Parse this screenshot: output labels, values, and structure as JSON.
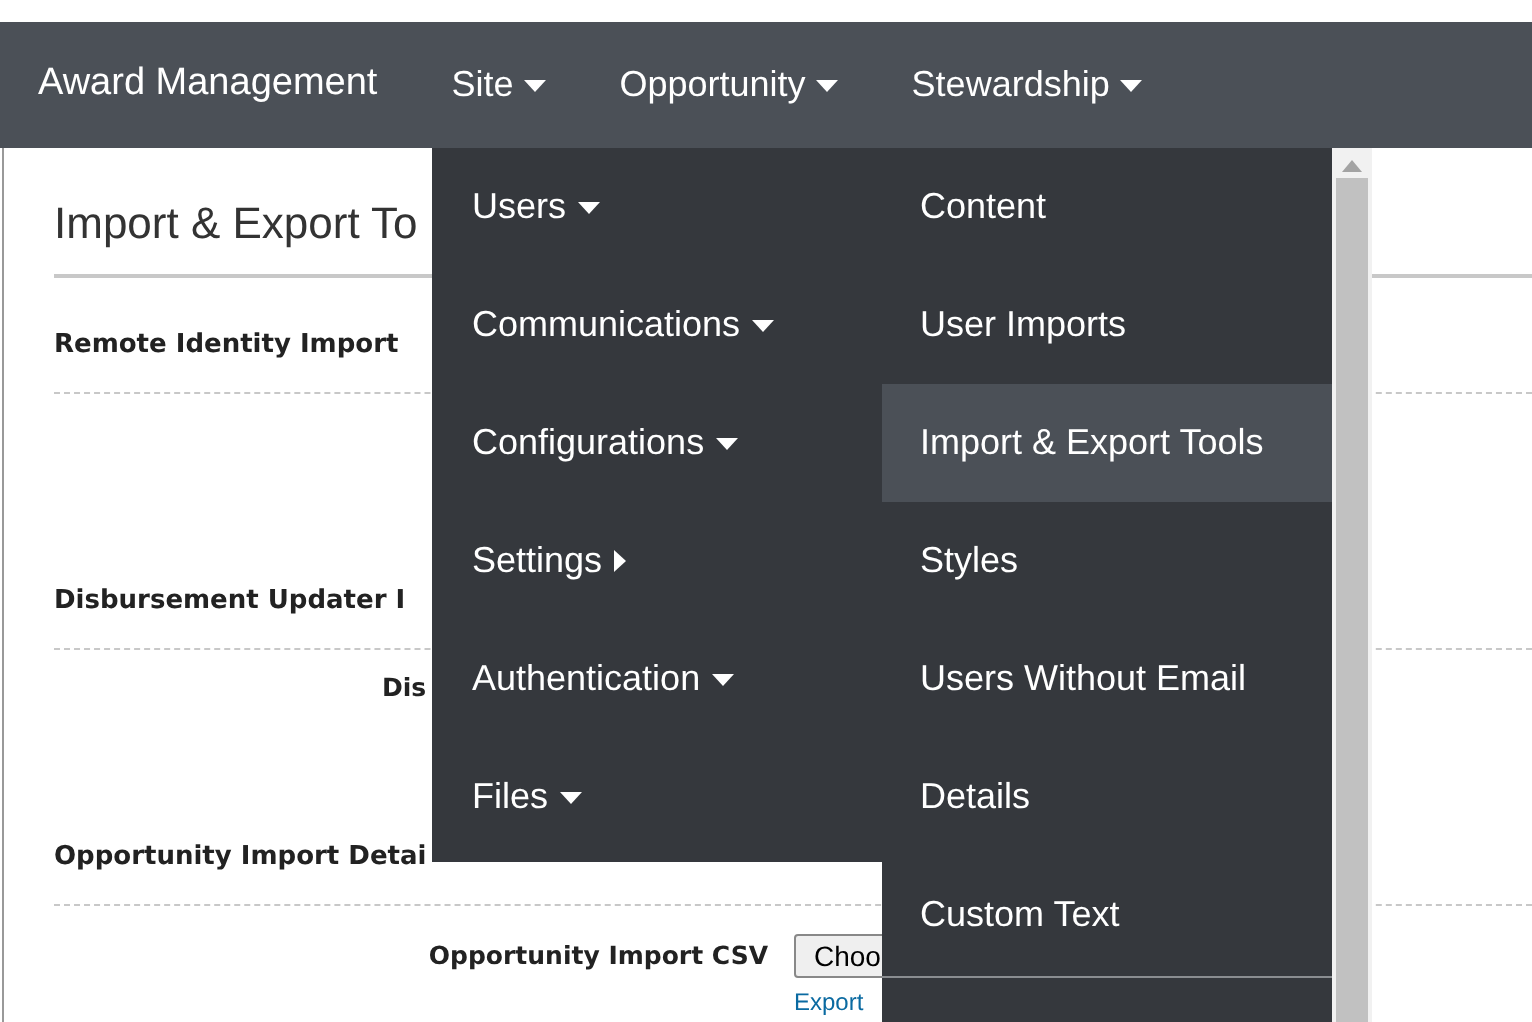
{
  "navbar": {
    "brand": "Award Management",
    "menus": [
      {
        "label": "Site"
      },
      {
        "label": "Opportunity"
      },
      {
        "label": "Stewardship"
      }
    ]
  },
  "page": {
    "title": "Import & Export To",
    "sections": [
      {
        "heading": "Remote Identity Import"
      },
      {
        "heading": "Disbursement Updater I",
        "field_label": "Dis"
      },
      {
        "heading": "Opportunity Import Detai",
        "field_label": "Opportunity Import CSV",
        "button": "Choo",
        "link": "Export"
      }
    ]
  },
  "dropdown": {
    "menu_items": [
      {
        "label": "Users",
        "kind": "dropdown"
      },
      {
        "label": "Communications",
        "kind": "dropdown"
      },
      {
        "label": "Configurations",
        "kind": "dropdown"
      },
      {
        "label": "Settings",
        "kind": "flyout"
      },
      {
        "label": "Authentication",
        "kind": "dropdown"
      },
      {
        "label": "Files",
        "kind": "dropdown"
      }
    ],
    "submenu_items": [
      {
        "label": "Content",
        "selected": false
      },
      {
        "label": "User Imports",
        "selected": false
      },
      {
        "label": "Import & Export Tools",
        "selected": true
      },
      {
        "label": "Styles",
        "selected": false
      },
      {
        "label": "Users Without Email",
        "selected": false
      },
      {
        "label": "Details",
        "selected": false
      },
      {
        "label": "Custom Text",
        "selected": false
      }
    ]
  }
}
